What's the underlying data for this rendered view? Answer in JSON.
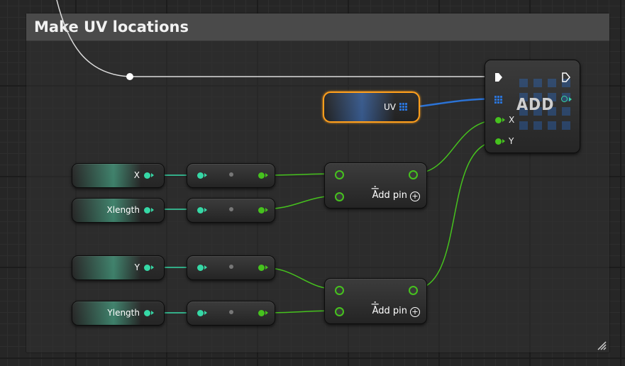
{
  "comment": {
    "title": "Make UV locations"
  },
  "variables": [
    {
      "label": "X"
    },
    {
      "label": "Xlength"
    },
    {
      "label": "Y"
    },
    {
      "label": "Ylength"
    }
  ],
  "divide_nodes": [
    {
      "symbol": "÷",
      "add_pin_label": "Add pin",
      "add_pin_icon": "+"
    },
    {
      "symbol": "÷",
      "add_pin_label": "Add pin",
      "add_pin_icon": "+"
    }
  ],
  "uv_node": {
    "label": "UV"
  },
  "add_node": {
    "title": "ADD",
    "pin_x": "X",
    "pin_y": "Y"
  },
  "colors": {
    "float_pin": "#46c21e",
    "variable_pin": "#36d8a6",
    "array_pin": "#2b73d6",
    "selection_outline": "#ff9f1c",
    "exec_wire": "#dddddd"
  },
  "icons": [
    "exec-pin-icon",
    "array-grid-icon",
    "add-pin-plus-icon",
    "resize-grip-icon"
  ]
}
